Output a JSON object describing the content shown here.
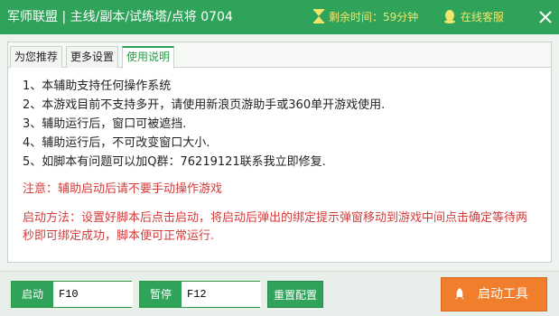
{
  "titlebar": {
    "title": "军师联盟 | 主线/副本/试练塔/点将 0704",
    "timer_text": "剩余时间：59分钟",
    "service_text": "在线客服"
  },
  "tabs": [
    "为您推荐",
    "更多设置",
    "使用说明"
  ],
  "rules": [
    "1、本辅助支持任何操作系统",
    "2、本游戏目前不支持多开，请使用新浪页游助手或360单开游戏使用.",
    "3、辅助运行后，窗口可被遮挡.",
    "4、辅助运行后，不可改变窗口大小.",
    "5、如脚本有问题可以加Q群：76219121联系我立即修复."
  ],
  "warning": "注意：辅助启动后请不要手动操作游戏",
  "method": "启动方法：设置好脚本后点击启动，将启动后弹出的绑定提示弹窗移动到游戏中间点击确定等待两秒即可绑定成功，脚本便可正常运行.",
  "footer": {
    "start_label": "启动",
    "start_value": "F10",
    "pause_label": "暂停",
    "pause_value": "F12",
    "reset_label": "重置配置",
    "launch_label": "启动工具"
  }
}
